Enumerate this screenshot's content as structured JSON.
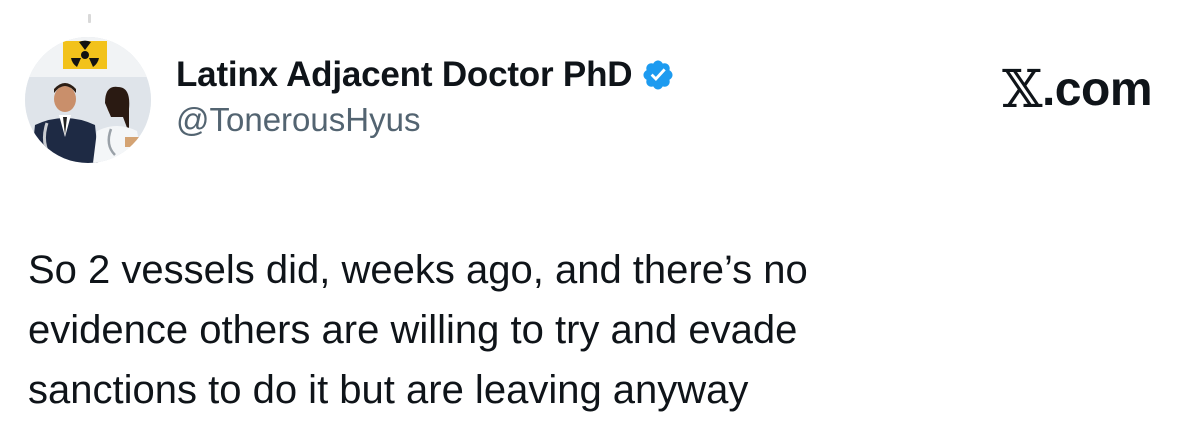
{
  "author": {
    "display_name": "Latinx Adjacent Doctor PhD",
    "handle": "@TonerousHyus",
    "verified": true,
    "avatar_icon": "profile-photo",
    "badge_color": "#1d9bf0"
  },
  "watermark": {
    "site": "X.com"
  },
  "tweet": {
    "lines": [
      "So 2 vessels did, weeks ago, and there’s no",
      "evidence others are willing to try and evade",
      "sanctions to do it but are leaving anyway"
    ]
  },
  "colors": {
    "text_primary": "#0f1419",
    "text_secondary": "#536471",
    "background": "#ffffff"
  }
}
